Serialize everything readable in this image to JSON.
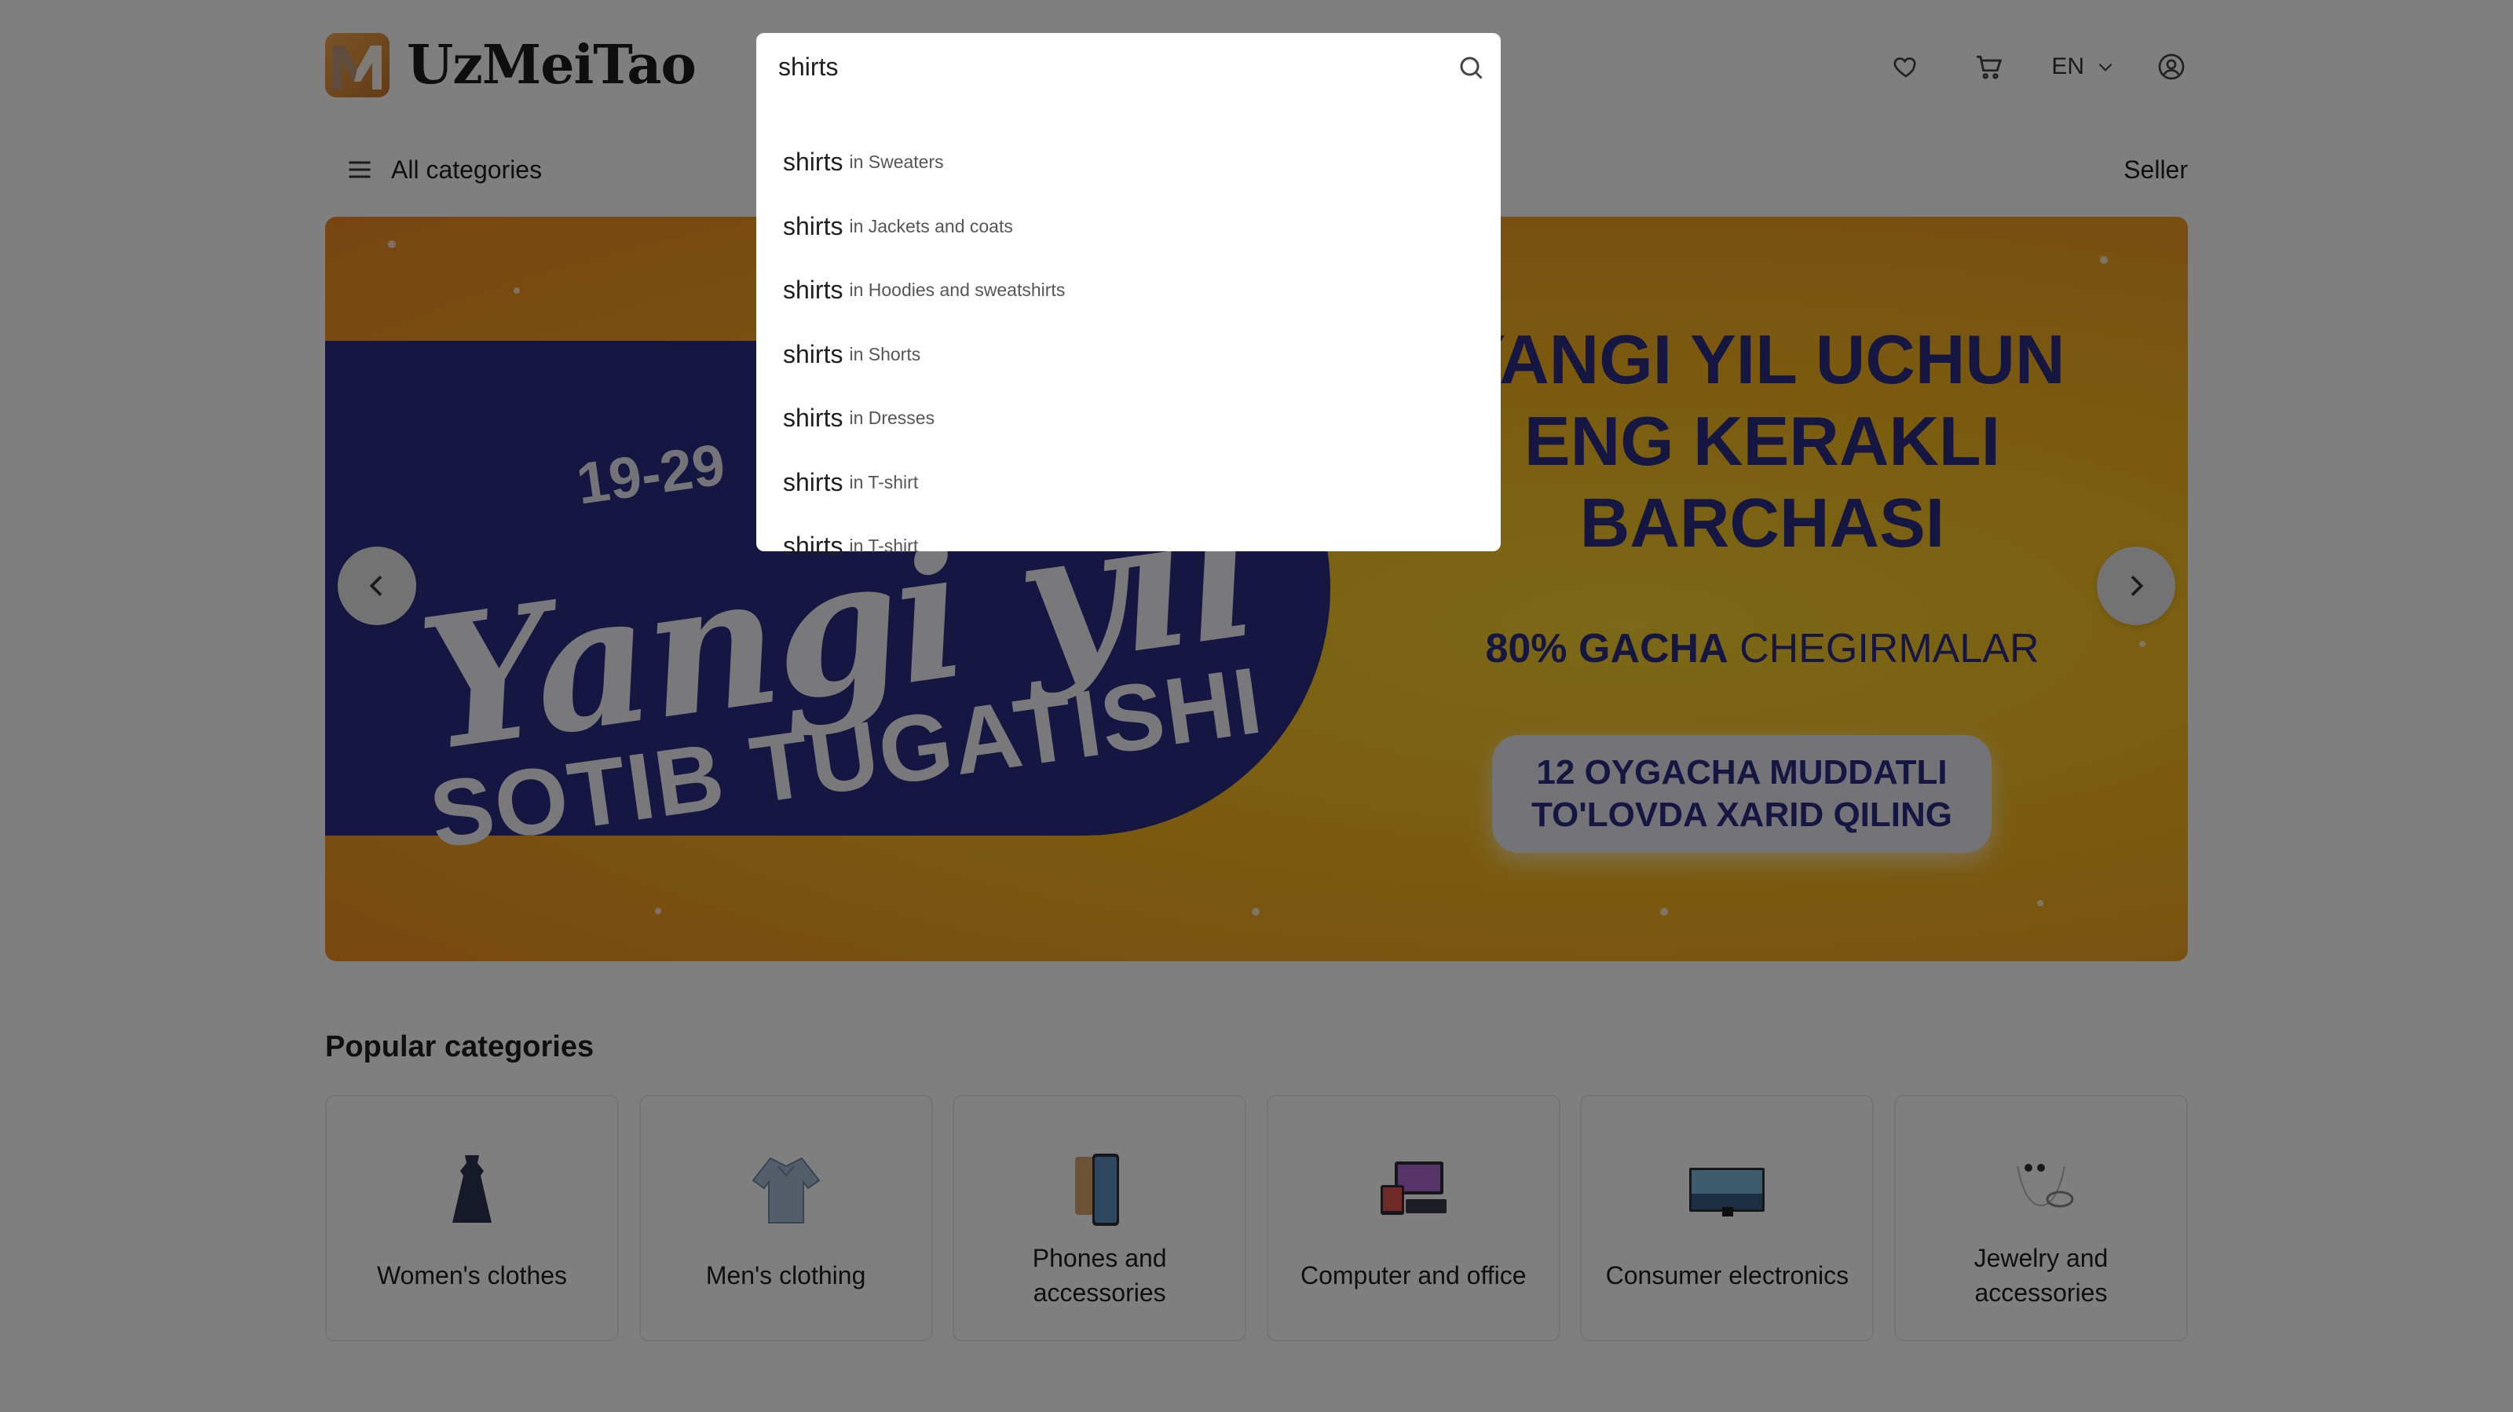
{
  "header": {
    "brand": "UzMeiTao",
    "lang": "EN",
    "all_categories": "All categories",
    "seller": "Seller"
  },
  "banner": {
    "date": "19-29",
    "script": "Yangi yil",
    "sub": "SOTIB TUGATISHI",
    "heading": "YANGI YIL UCHUN ENG KERAKLI BARCHASI",
    "promo_bold": "80% GACHA",
    "promo_rest": "CHEGIRMALAR",
    "pill": "12 OYGACHA MUDDATLI\nTO'LOVDA XARID QILING",
    "colors": {
      "blue": "#2d2d86",
      "yellow": "#f6b81e",
      "orange": "#f08a25"
    }
  },
  "popular": {
    "title": "Popular categories",
    "items": [
      {
        "label": "Women's clothes",
        "icon": "dress-icon"
      },
      {
        "label": "Men's clothing",
        "icon": "shirt-icon"
      },
      {
        "label": "Phones and accessories",
        "icon": "phone-icon"
      },
      {
        "label": "Computer and office",
        "icon": "computer-icon"
      },
      {
        "label": "Consumer electronics",
        "icon": "tv-icon"
      },
      {
        "label": "Jewelry and accessories",
        "icon": "jewelry-icon"
      }
    ]
  },
  "search": {
    "value": "shirts",
    "suggestions": [
      {
        "term": "shirts",
        "category": "in Sweaters"
      },
      {
        "term": "shirts",
        "category": "in Jackets and coats"
      },
      {
        "term": "shirts",
        "category": "in Hoodies and sweatshirts"
      },
      {
        "term": "shirts",
        "category": "in Shorts"
      },
      {
        "term": "shirts",
        "category": "in Dresses"
      },
      {
        "term": "shirts",
        "category": "in T-shirt"
      },
      {
        "term": "shirts",
        "category": "in T-shirt"
      }
    ]
  }
}
